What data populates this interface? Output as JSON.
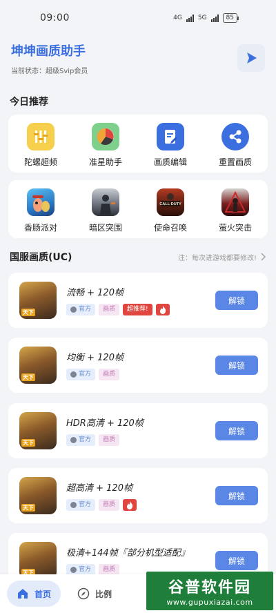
{
  "status": {
    "time": "09:00",
    "net1": "4G",
    "net2": "5G",
    "battery": "85"
  },
  "header": {
    "title": "坤坤画质助手",
    "subtitle": "当前状态：超级Svip会员"
  },
  "sections": {
    "today": "今日推荐",
    "uc": "国服画质(UC)",
    "uc_note": "注：每次进游戏都要修改!"
  },
  "tools": [
    {
      "label": "陀螺超频",
      "icon": "gyro-icon",
      "color": "#f6cf4c"
    },
    {
      "label": "准星助手",
      "icon": "crosshair-pie-icon",
      "color": "#7fd08d"
    },
    {
      "label": "画质编辑",
      "icon": "edit-doc-icon",
      "color": "#3b6fe0"
    },
    {
      "label": "重置画质",
      "icon": "share-icon",
      "color": "#3b6fe0"
    }
  ],
  "games": [
    {
      "label": "香肠派对",
      "icon": "sausage-party-icon"
    },
    {
      "label": "暗区突围",
      "icon": "arena-breakout-icon"
    },
    {
      "label": "使命召唤",
      "icon": "call-of-duty-icon"
    },
    {
      "label": "萤火突击",
      "icon": "firefly-assault-icon"
    }
  ],
  "presets": [
    {
      "name": "流畅 + 120帧",
      "tag_official": "官方",
      "tag_quality": "画质",
      "tag_hot": "超推荐!",
      "fire": true,
      "thumb_badge": "天下",
      "button": "解锁"
    },
    {
      "name": "均衡 + 120帧",
      "tag_official": "官方",
      "tag_quality": "画质",
      "tag_hot": "",
      "fire": false,
      "thumb_badge": "天下",
      "button": "解锁"
    },
    {
      "name": "HDR高清 + 120帧",
      "tag_official": "官方",
      "tag_quality": "画质",
      "tag_hot": "",
      "fire": false,
      "thumb_badge": "天下",
      "button": "解锁"
    },
    {
      "name": "超高清 + 120帧",
      "tag_official": "官方",
      "tag_quality": "画质",
      "tag_hot": "",
      "fire": true,
      "thumb_badge": "天下",
      "button": "解锁"
    },
    {
      "name": "极清+144帧『部分机型适配』",
      "tag_official": "官方",
      "tag_quality": "画质",
      "tag_hot": "",
      "fire": false,
      "thumb_badge": "天下",
      "button": "解锁"
    }
  ],
  "nav": {
    "home": "首页",
    "ratio": "比例"
  },
  "watermark": {
    "main": "谷普软件园",
    "url": "www.gupuxiazai.com"
  },
  "colors": {
    "accent": "#3b6fe0",
    "button": "#5a86e6",
    "hot": "#e0463f"
  }
}
